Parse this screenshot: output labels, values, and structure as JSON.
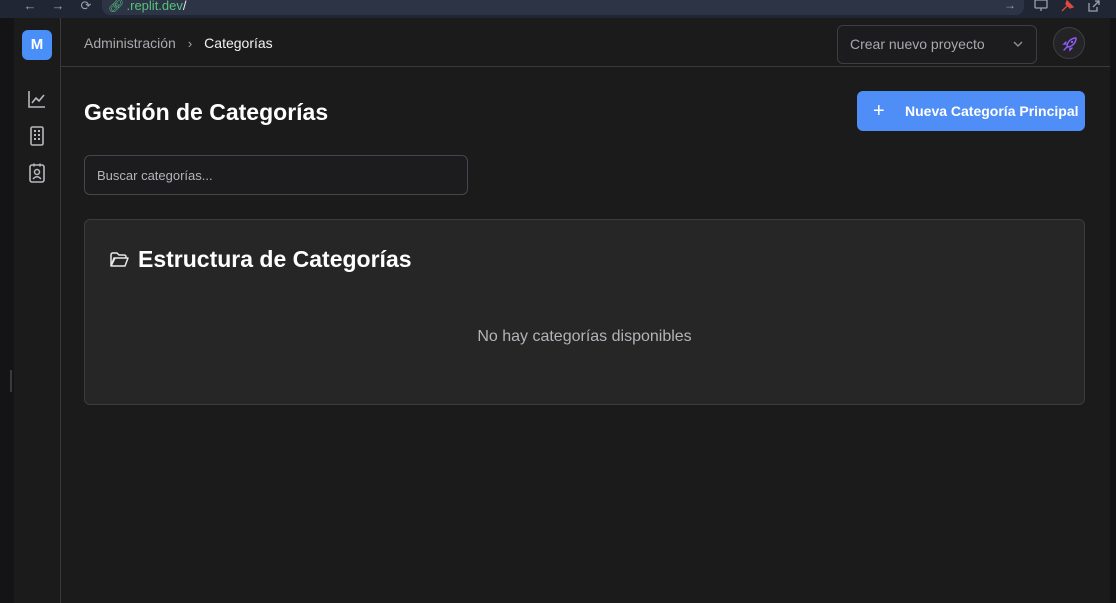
{
  "browser": {
    "back_icon": "←",
    "forward_icon": "→",
    "reload_icon": "⟳",
    "url_domain": ".replit.dev",
    "url_path": "/",
    "go_icon": "→"
  },
  "sidebar": {
    "avatar_letter": "M",
    "items": [
      {
        "icon": "line-chart-icon"
      },
      {
        "icon": "building-icon"
      },
      {
        "icon": "contact-card-icon"
      }
    ]
  },
  "header": {
    "breadcrumb": [
      "Administración",
      "Categorías"
    ],
    "breadcrumb_separator": "›",
    "project_select": {
      "placeholder": "Crear nuevo proyecto"
    },
    "rocket_icon": "rocket-icon",
    "rocket_color": "#8b5cf6"
  },
  "main": {
    "title": "Gestión de Categorías",
    "new_button": {
      "icon": "+",
      "label": "Nueva Categoría Principal"
    },
    "search": {
      "placeholder": "Buscar categorías...",
      "value": ""
    },
    "card": {
      "icon": "folder-open-icon",
      "title": "Estructura de Categorías",
      "empty_message": "No hay categorías disponibles"
    }
  },
  "colors": {
    "accent": "#4f8ef7",
    "background": "#1b1b1c",
    "card": "#262627"
  }
}
